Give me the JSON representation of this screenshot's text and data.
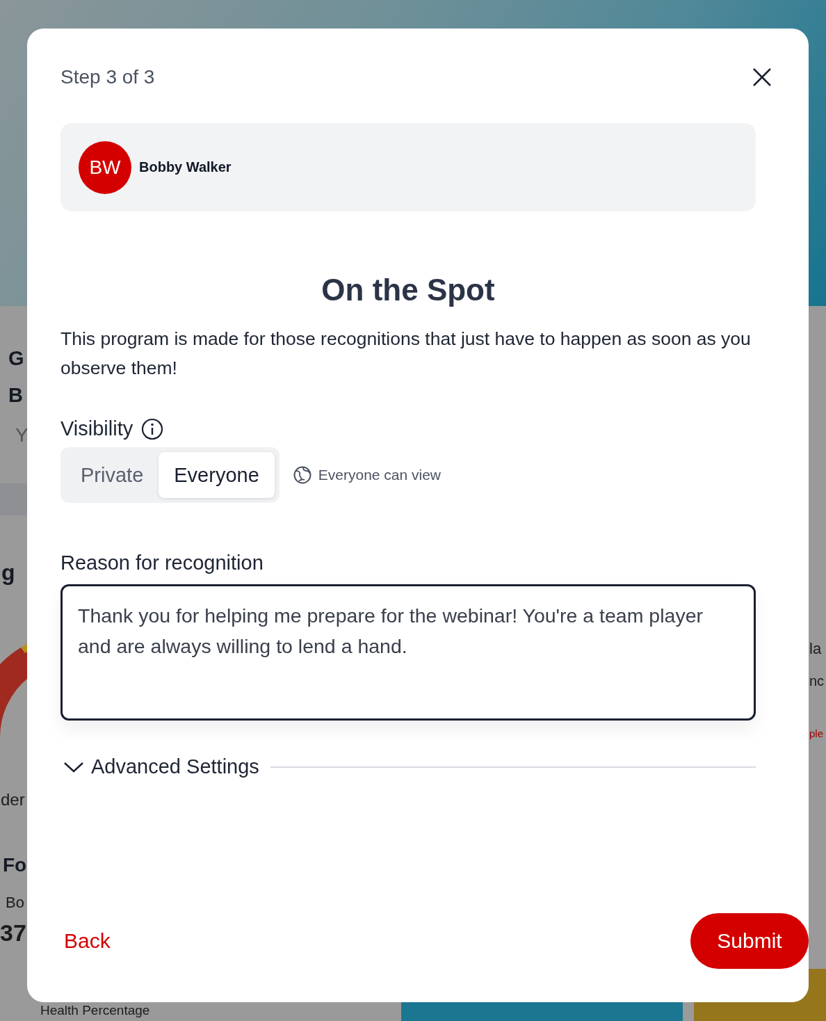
{
  "background_page": {
    "fragments": [
      {
        "text": "G",
        "kind": "heading"
      },
      {
        "text": "B",
        "kind": "heading"
      },
      {
        "text": "Y",
        "kind": "muted"
      },
      {
        "text": "g",
        "kind": "heading"
      },
      {
        "text": "der",
        "kind": "plain"
      },
      {
        "text": "Fo",
        "kind": "heading"
      },
      {
        "text": "Bo",
        "kind": "plain"
      },
      {
        "text": "37",
        "kind": "big"
      },
      {
        "text": "Health Percentage",
        "kind": "plain"
      },
      {
        "text": "la",
        "kind": "plain"
      },
      {
        "text": "nc",
        "kind": "plain"
      },
      {
        "text": "ple",
        "kind": "link"
      }
    ]
  },
  "modal": {
    "step": "Step 3 of 3",
    "recipient": {
      "initials": "BW",
      "name": "Bobby Walker"
    },
    "title": "On the Spot",
    "description": "This program is made for those recognitions that just have to happen as soon as you observe them!",
    "visibility": {
      "label": "Visibility",
      "options": [
        {
          "label": "Private",
          "selected": false
        },
        {
          "label": "Everyone",
          "selected": true
        }
      ],
      "note": "Everyone can view"
    },
    "reason": {
      "label": "Reason for recognition",
      "value": "Thank you for helping me prepare for the webinar! You're a team player and are always willing to lend a hand."
    },
    "advanced": {
      "label": "Advanced Settings",
      "expanded": false
    },
    "buttons": {
      "back": "Back",
      "submit": "Submit"
    }
  }
}
